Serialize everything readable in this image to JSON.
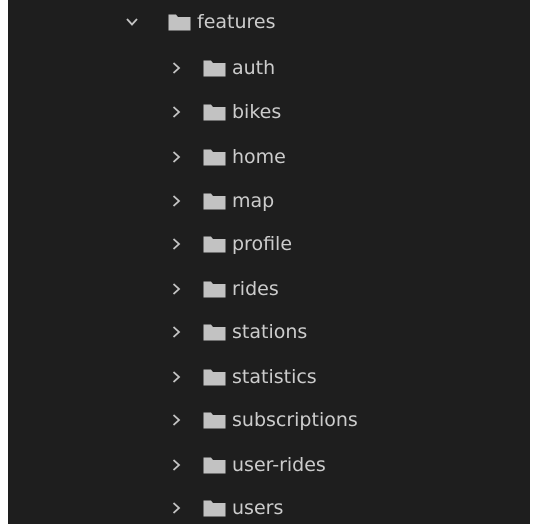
{
  "explorer": {
    "root": {
      "label": "features",
      "expanded": true,
      "icon": "folder-icon",
      "chevron": "chevron-down-icon"
    },
    "children": [
      {
        "label": "auth"
      },
      {
        "label": "bikes"
      },
      {
        "label": "home"
      },
      {
        "label": "map"
      },
      {
        "label": "profile"
      },
      {
        "label": "rides"
      },
      {
        "label": "stations"
      },
      {
        "label": "statistics"
      },
      {
        "label": "subscriptions"
      },
      {
        "label": "user-rides"
      },
      {
        "label": "users"
      }
    ],
    "child_chevron": "chevron-right-icon",
    "colors": {
      "background": "#1e1e1e",
      "text": "#cccccc",
      "folder": "#c2c2c2",
      "chevron": "#c5c5c5"
    }
  }
}
